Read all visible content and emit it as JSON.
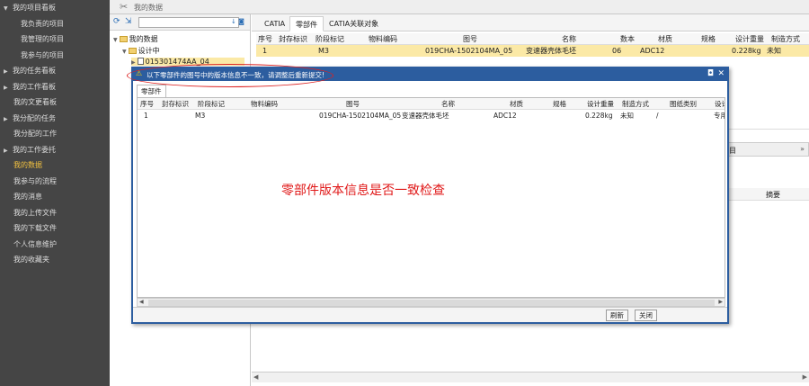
{
  "sidebar": {
    "items": [
      {
        "label": "我的项目看板",
        "type": "group",
        "arrow": "▼"
      },
      {
        "label": "我负责的项目",
        "type": "sub"
      },
      {
        "label": "我管理的项目",
        "type": "sub"
      },
      {
        "label": "我参与的项目",
        "type": "sub"
      },
      {
        "label": "我的任务看板",
        "type": "group",
        "arrow": "▶"
      },
      {
        "label": "我的工作看板",
        "type": "group",
        "arrow": "▶"
      },
      {
        "label": "我的文更看板",
        "type": "item"
      },
      {
        "label": "我分配的任务",
        "type": "group",
        "arrow": "▶"
      },
      {
        "label": "我分配的工作",
        "type": "item"
      },
      {
        "label": "我的工作委托",
        "type": "group",
        "arrow": "▶"
      },
      {
        "label": "我的数据",
        "type": "item",
        "active": true
      },
      {
        "label": "我参与的流程",
        "type": "item"
      },
      {
        "label": "我的消息",
        "type": "item"
      },
      {
        "label": "我的上传文件",
        "type": "item"
      },
      {
        "label": "我的下载文件",
        "type": "item"
      },
      {
        "label": "个人信息维护",
        "type": "item"
      },
      {
        "label": "我的收藏夹",
        "type": "item"
      }
    ]
  },
  "topbar": {
    "title": "我的数据",
    "logo_icon": "scissors-icon"
  },
  "tree": {
    "toolbar_icons": [
      "refresh-icon",
      "expand-icon"
    ],
    "search_placeholder": "",
    "search_buttons": "↓ ◙",
    "nodes": [
      {
        "label": "我的数据",
        "level": 0,
        "toggle": "▼"
      },
      {
        "label": "设计中",
        "level": 1,
        "toggle": "▼"
      },
      {
        "label": "015301474AA_04",
        "level": 2,
        "toggle": "▶",
        "selected": true
      }
    ]
  },
  "main": {
    "tabs": [
      "CATIA",
      "零部件",
      "CATIA关联对象"
    ],
    "active_tab": 1,
    "columns": [
      "序号",
      "封存标识",
      "阶段标记",
      "物料编码",
      "图号",
      "名称",
      "数本",
      "材质",
      "规格",
      "设计重量",
      "制造方式"
    ],
    "rows": [
      [
        "1",
        "",
        "M3",
        "",
        "019CHA-1502104MA_05",
        "变速器壳体毛坯",
        "06",
        "ADC12",
        "",
        "0.228kg",
        "未知"
      ]
    ],
    "lower_bar_label": "目",
    "lower_header_label": "摘要"
  },
  "dialog": {
    "title": "以下零部件的图号中的版本信息不一致，请调整后重新提交!",
    "tab_label": "零部件",
    "columns": [
      "序号",
      "封存标识",
      "阶段标记",
      "物料编码",
      "图号",
      "名称",
      "材质",
      "规格",
      "设计重量",
      "制造方式",
      "图纸类别",
      "设计"
    ],
    "rows": [
      [
        "1",
        "",
        "M3",
        "",
        "019CHA-1502104MA_05",
        "变速器壳体毛坯",
        "ADC12",
        "",
        "0.228kg",
        "未知",
        "/",
        "专用件"
      ]
    ],
    "refresh_label": "刷新",
    "close_label": "关闭"
  },
  "annotation": "零部件版本信息是否一致检查",
  "colors": {
    "sidebar_bg": "#454545",
    "dialog_border": "#2c5d9f",
    "selected_row": "#fbe9a6",
    "annotation": "#e01818"
  }
}
